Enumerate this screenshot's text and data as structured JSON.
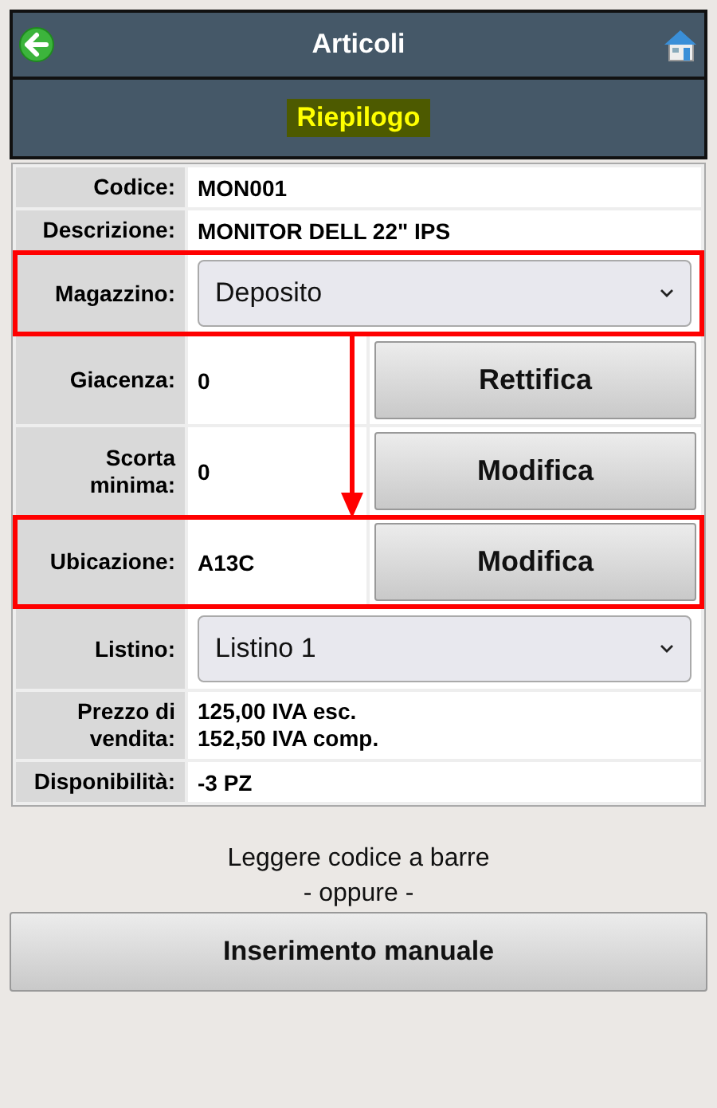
{
  "header": {
    "title": "Articoli"
  },
  "section": {
    "title": "Riepilogo"
  },
  "rows": [
    {
      "label": "Codice:",
      "kind": "text",
      "value": "MON001",
      "highlighted": false
    },
    {
      "label": "Descrizione:",
      "kind": "text",
      "value": "MONITOR DELL 22\" IPS",
      "highlighted": false
    },
    {
      "label": "Magazzino:",
      "kind": "select",
      "value": "Deposito",
      "highlighted": true
    },
    {
      "label": "Giacenza:",
      "kind": "action",
      "value": "0",
      "button": "Rettifica",
      "highlighted": false
    },
    {
      "label": "Scorta minima:",
      "kind": "action",
      "value": "0",
      "button": "Modifica",
      "highlighted": false
    },
    {
      "label": "Ubicazione:",
      "kind": "action",
      "value": "A13C",
      "button": "Modifica",
      "highlighted": true
    },
    {
      "label": "Listino:",
      "kind": "select",
      "value": "Listino 1",
      "highlighted": false
    },
    {
      "label": "Prezzo di vendita:",
      "kind": "lines",
      "lines": [
        "125,00 IVA esc.",
        "152,50 IVA comp."
      ],
      "highlighted": false
    },
    {
      "label": "Disponibilità:",
      "kind": "text",
      "value": "-3 PZ",
      "highlighted": false
    }
  ],
  "footer": {
    "hint": "Leggere codice a barre",
    "separator": "- oppure -",
    "button": "Inserimento manuale"
  }
}
